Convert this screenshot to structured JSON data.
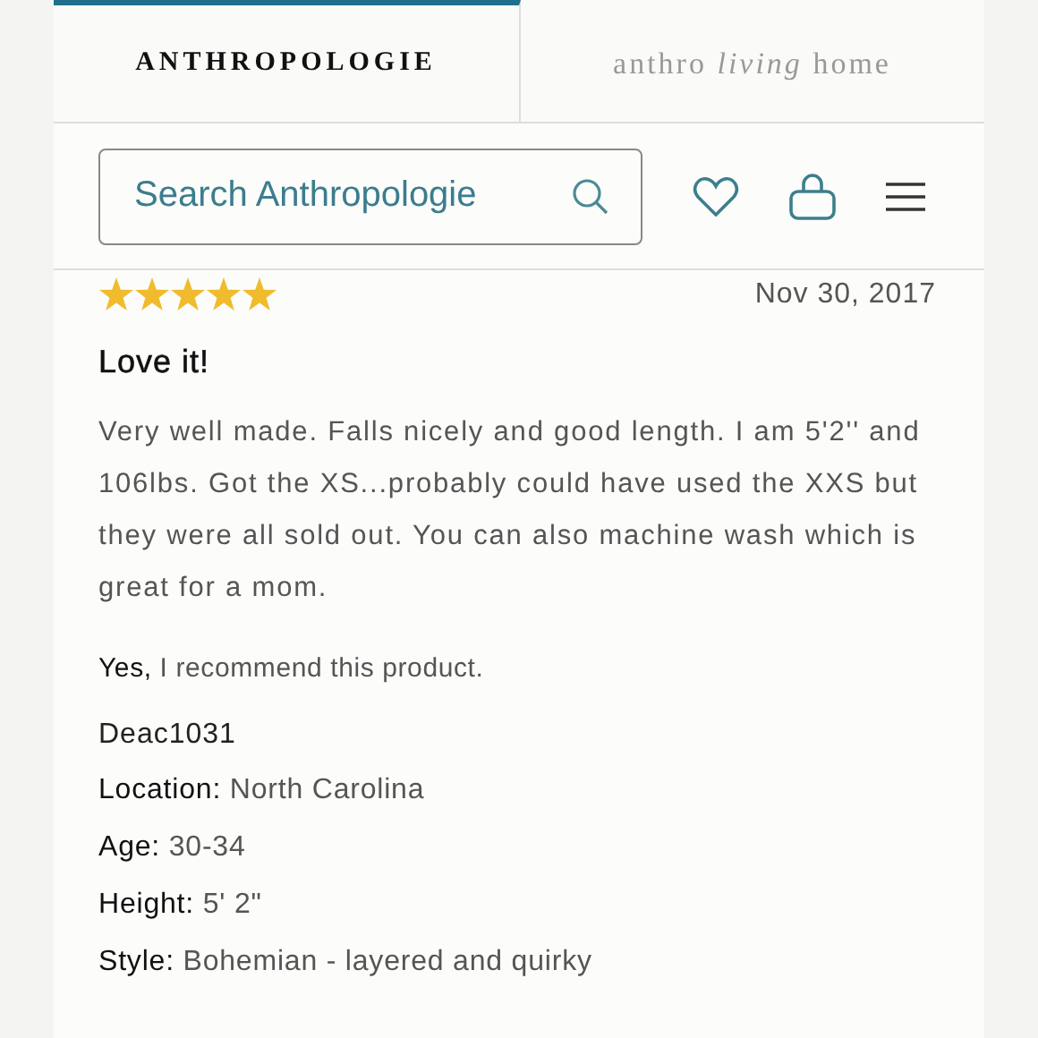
{
  "tabs": [
    {
      "label": "ANTHROPOLOGIE",
      "selected": true
    },
    {
      "label": "anthro *living* home",
      "selected": false
    }
  ],
  "search": {
    "placeholder": "Search Anthropologie"
  },
  "review": {
    "stars": 5,
    "date": "Nov 30, 2017",
    "title": "Love it!",
    "body": "Very well made. Falls nicely and good length. I am 5'2'' and 106lbs. Got the XS...probably could have used the XXS but they were all sold out. You can also machine wash which is great for a mom.",
    "recommendation": "**Yes,** I recommend this product.",
    "author": "Deac1031",
    "details": [
      "**Location:** North Carolina",
      "**Age:** 30-34",
      "**Height:** 5' 2\"",
      "**Style:** Bohemian - layered and quirky"
    ]
  }
}
